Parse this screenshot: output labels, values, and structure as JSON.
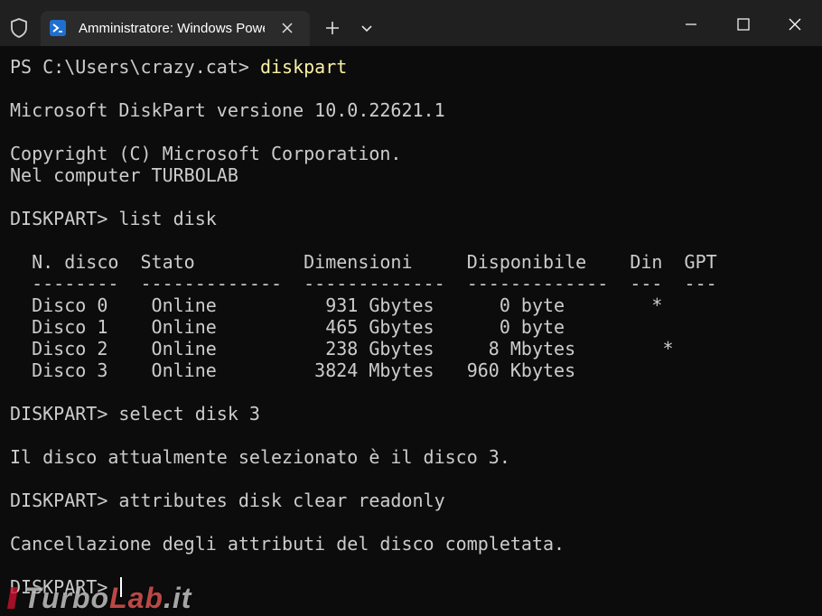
{
  "window": {
    "tab_title": "Amministratore: Windows PowerShell",
    "icons": {
      "shield": "shield-icon",
      "powershell": "powershell-icon",
      "tab_close": "close-icon",
      "new_tab": "plus-icon",
      "dropdown": "chevron-down-icon",
      "minimize": "minimize-icon",
      "maximize": "maximize-icon",
      "close": "close-icon"
    }
  },
  "colors": {
    "terminal_bg": "#0c0c0c",
    "text": "#cccccc",
    "command": "#f9f1a5",
    "titlebar": "#202020",
    "tab": "#2b2b2b",
    "ps_blue": "#1f6fd1"
  },
  "terminal": {
    "lines": [
      {
        "prompt": "PS C:\\Users\\crazy.cat> ",
        "command": "diskpart"
      },
      {
        "text": ""
      },
      {
        "text": "Microsoft DiskPart versione 10.0.22621.1"
      },
      {
        "text": ""
      },
      {
        "text": "Copyright (C) Microsoft Corporation."
      },
      {
        "text": "Nel computer TURBOLAB"
      },
      {
        "text": ""
      },
      {
        "text": "DISKPART> list disk"
      },
      {
        "text": ""
      },
      {
        "text": "  N. disco  Stato          Dimensioni     Disponibile    Din  GPT"
      },
      {
        "text": "  --------  -------------  -------------  -------------  ---  ---"
      },
      {
        "text": "  Disco 0    Online          931 Gbytes      0 byte        *"
      },
      {
        "text": "  Disco 1    Online          465 Gbytes      0 byte"
      },
      {
        "text": "  Disco 2    Online          238 Gbytes     8 Mbytes        *"
      },
      {
        "text": "  Disco 3    Online         3824 Mbytes   960 Kbytes"
      },
      {
        "text": ""
      },
      {
        "text": "DISKPART> select disk 3"
      },
      {
        "text": ""
      },
      {
        "text": "Il disco attualmente selezionato è il disco 3."
      },
      {
        "text": ""
      },
      {
        "text": "DISKPART> attributes disk clear readonly"
      },
      {
        "text": ""
      },
      {
        "text": "Cancellazione degli attributi del disco completata."
      },
      {
        "text": ""
      },
      {
        "text": "DISKPART> "
      }
    ]
  },
  "watermark": {
    "part1": "Turbo",
    "part2": "Lab",
    "part3": ".it"
  }
}
